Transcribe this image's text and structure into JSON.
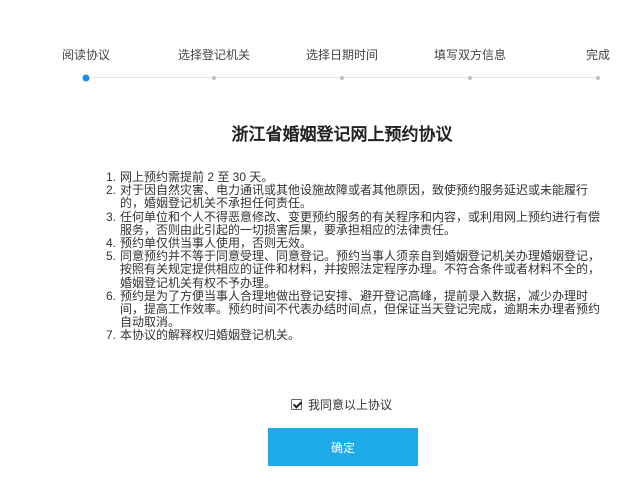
{
  "steps": [
    {
      "label": "阅读协议",
      "active": true
    },
    {
      "label": "选择登记机关",
      "active": false
    },
    {
      "label": "选择日期时间",
      "active": false
    },
    {
      "label": "填写双方信息",
      "active": false
    },
    {
      "label": "完成",
      "active": false
    }
  ],
  "agreement": {
    "title": "浙江省婚姻登记网上预约协议",
    "items": [
      {
        "num": "1.",
        "text": "网上预约需提前 2 至 30 天。"
      },
      {
        "num": "2.",
        "text": "对于因自然灾害、电力通讯或其他设施故障或者其他原因，致使预约服务延迟或未能履行的，婚姻登记机关不承担任何责任。"
      },
      {
        "num": "3.",
        "text": "任何单位和个人不得恶意修改、变更预约服务的有关程序和内容，或利用网上预约进行有偿服务，否则由此引起的一切损害后果，要承担相应的法律责任。"
      },
      {
        "num": "4.",
        "text": "预约单仅供当事人使用，否则无效。"
      },
      {
        "num": "5.",
        "text": "同意预约并不等于同意受理、同意登记。预约当事人须亲自到婚姻登记机关办理婚姻登记，按照有关规定提供相应的证件和材料，并按照法定程序办理。不符合条件或者材料不全的，婚姻登记机关有权不予办理。"
      },
      {
        "num": "6.",
        "text": "预约是为了方便当事人合理地做出登记安排、避开登记高峰，提前录入数据，减少办理时间，提高工作效率。预约时间不代表办结时间点，但保证当天登记完成，逾期未办理者预约自动取消。"
      },
      {
        "num": "7.",
        "text": "本协议的解释权归婚姻登记机关。"
      }
    ]
  },
  "consent": {
    "label": "我同意以上协议",
    "checked": true,
    "icon": "checkmark-icon"
  },
  "confirm_button": {
    "label": "确定"
  },
  "colors": {
    "accent": "#1E8FE1",
    "button": "#1EA9E8",
    "dot": "#BDBDBD",
    "text": "#333333"
  }
}
